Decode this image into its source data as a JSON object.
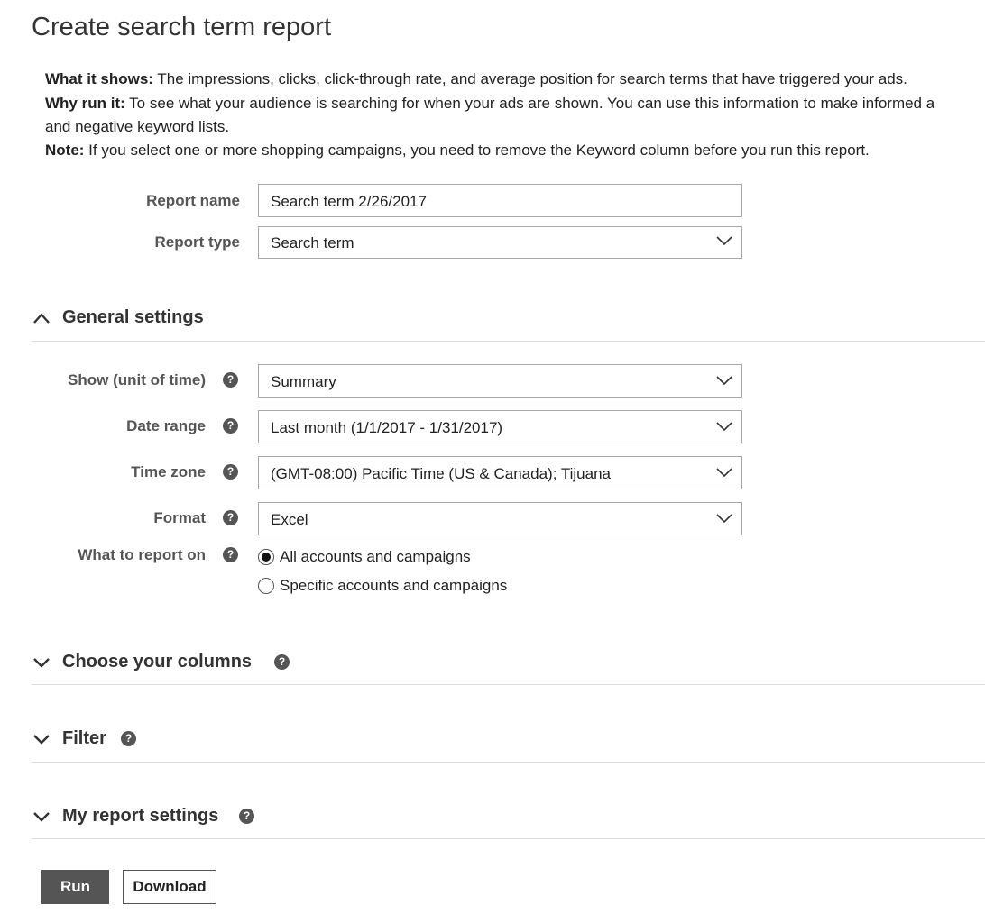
{
  "page": {
    "title": "Create search term report"
  },
  "intro": {
    "what_label": "What it shows:",
    "what_text": " The impressions, clicks, click-through rate, and average position for search terms that have triggered your ads.",
    "why_label": "Why run it:",
    "why_text": " To see what your audience is searching for when your ads are shown. You can use this information to make informed a",
    "why_text_cont": "and negative keyword lists.",
    "note_label": "Note:",
    "note_text": " If you select one or more shopping campaigns, you need to remove the Keyword column before you run this report."
  },
  "form": {
    "report_name_label": "Report name",
    "report_name_value": "Search term 2/26/2017",
    "report_type_label": "Report type",
    "report_type_value": "Search term"
  },
  "general": {
    "heading": "General settings",
    "unit_label": "Show (unit of time)",
    "unit_value": "Summary",
    "date_label": "Date range",
    "date_value": "Last month (1/1/2017 - 1/31/2017)",
    "tz_label": "Time zone",
    "tz_value": "(GMT-08:00) Pacific Time (US & Canada); Tijuana",
    "format_label": "Format",
    "format_value": "Excel",
    "report_on_label": "What to report on",
    "options": [
      "All accounts and campaigns",
      "Specific accounts and campaigns"
    ],
    "selected_option": "All accounts and campaigns"
  },
  "sections": {
    "columns": "Choose your columns",
    "filter": "Filter",
    "my_settings": "My report settings"
  },
  "help_glyph": "?",
  "actions": {
    "run": "Run",
    "download": "Download"
  },
  "colors": {
    "button_dark": "#555555",
    "rule": "#dcdcdc",
    "border": "#a8a8a8"
  }
}
